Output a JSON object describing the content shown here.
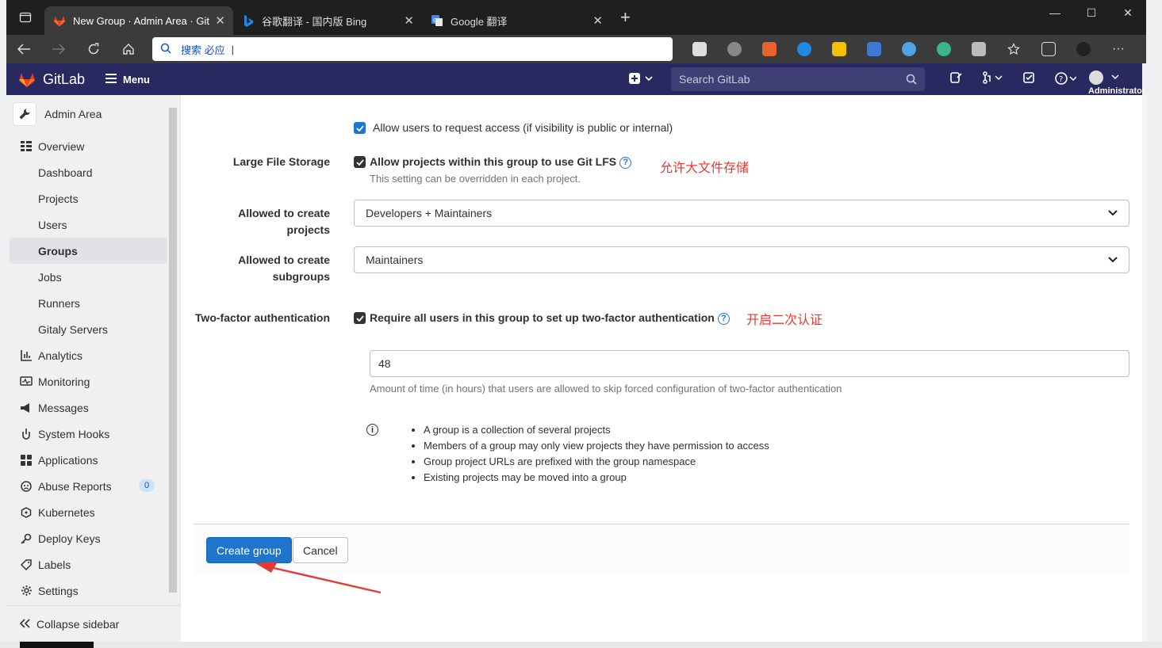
{
  "browser": {
    "tabs": [
      {
        "title": "New Group · Admin Area · GitLab",
        "active": true
      },
      {
        "title": "谷歌翻译 - 国内版 Bing",
        "active": false
      },
      {
        "title": "Google 翻译",
        "active": false
      }
    ],
    "address": "搜索 必应"
  },
  "header": {
    "brand": "GitLab",
    "menu_label": "Menu",
    "search_placeholder": "Search GitLab",
    "user_label": "Administrator"
  },
  "sidebar": {
    "title": "Admin Area",
    "items": [
      {
        "label": "Overview",
        "icon": "overview-icon",
        "level": "top"
      },
      {
        "label": "Dashboard",
        "level": "sub"
      },
      {
        "label": "Projects",
        "level": "sub"
      },
      {
        "label": "Users",
        "level": "sub"
      },
      {
        "label": "Groups",
        "level": "sub",
        "active": true
      },
      {
        "label": "Jobs",
        "level": "sub"
      },
      {
        "label": "Runners",
        "level": "sub"
      },
      {
        "label": "Gitaly Servers",
        "level": "sub"
      },
      {
        "label": "Analytics",
        "icon": "analytics-icon",
        "level": "top"
      },
      {
        "label": "Monitoring",
        "icon": "monitoring-icon",
        "level": "top"
      },
      {
        "label": "Messages",
        "icon": "messages-icon",
        "level": "top"
      },
      {
        "label": "System Hooks",
        "icon": "hooks-icon",
        "level": "top"
      },
      {
        "label": "Applications",
        "icon": "applications-icon",
        "level": "top"
      },
      {
        "label": "Abuse Reports",
        "icon": "abuse-icon",
        "level": "top",
        "badge": "0"
      },
      {
        "label": "Kubernetes",
        "icon": "kubernetes-icon",
        "level": "top"
      },
      {
        "label": "Deploy Keys",
        "icon": "key-icon",
        "level": "top"
      },
      {
        "label": "Labels",
        "icon": "label-icon",
        "level": "top"
      },
      {
        "label": "Settings",
        "icon": "settings-icon",
        "level": "top"
      }
    ],
    "collapse_label": "Collapse sidebar"
  },
  "form": {
    "request_access_label": "Allow users to request access (if visibility is public or internal)",
    "lfs": {
      "label": "Large File Storage",
      "checkbox_label": "Allow projects within this group to use Git LFS",
      "help": "This setting can be overridden in each project.",
      "annotation": "允许大文件存储"
    },
    "create_projects": {
      "label": "Allowed to create projects",
      "value": "Developers + Maintainers"
    },
    "create_subgroups": {
      "label_line1": "Allowed to create",
      "label_line2": "subgroups",
      "value": "Maintainers"
    },
    "two_factor": {
      "label": "Two-factor authentication",
      "checkbox_label": "Require all users in this group to set up two-factor authentication",
      "annotation": "开启二次认证",
      "grace_value": "48",
      "grace_help": "Amount of time (in hours) that users are allowed to skip forced configuration of two-factor authentication"
    },
    "info_bullets": [
      "A group is a collection of several projects",
      "Members of a group may only view projects they have permission to access",
      "Group project URLs are prefixed with the group namespace",
      "Existing projects may be moved into a group"
    ],
    "create_button": "Create group",
    "cancel_button": "Cancel"
  },
  "colors": {
    "header_bg": "#292961",
    "primary": "#1f75cb",
    "annotation": "#e53935"
  }
}
